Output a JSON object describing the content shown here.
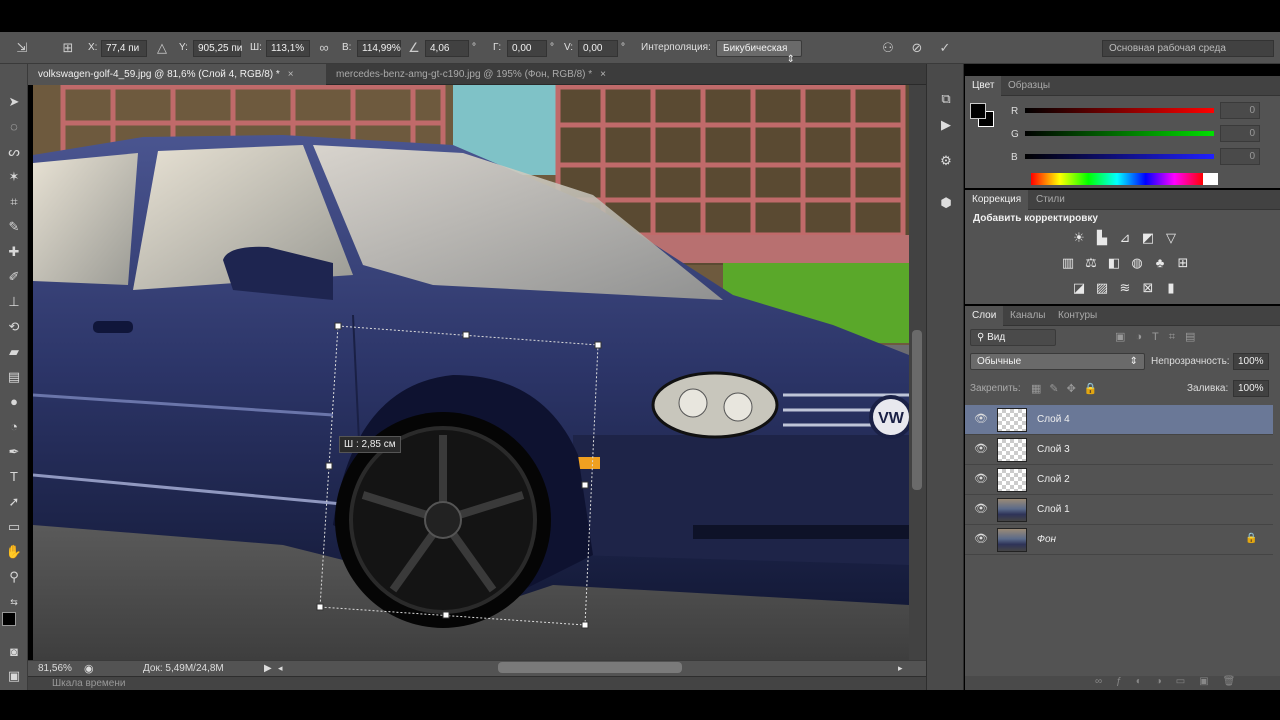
{
  "options_bar": {
    "x_label": "X:",
    "x_value": "77,4 пи",
    "y_label": "Y:",
    "y_value": "905,25 пи",
    "w_label": "Ш:",
    "w_value": "113,1%",
    "h_label": "В:",
    "h_value": "114,99%",
    "angle_value": "4,06",
    "hskew_label": "Г:",
    "hskew_value": "0,00",
    "vskew_label": "V:",
    "vskew_value": "0,00",
    "interp_label": "Интерполяция:",
    "interp_value": "Бикубическая",
    "workspace": "Основная рабочая среда"
  },
  "tabs": [
    {
      "label": "volkswagen-golf-4_59.jpg @ 81,6% (Слой 4, RGB/8) *"
    },
    {
      "label": "mercedes-benz-amg-gt-c190.jpg @ 195% (Фон, RGB/8) *"
    }
  ],
  "canvas": {
    "transform_tooltip": "Ш : 2,85 см",
    "brand": "VW"
  },
  "status": {
    "zoom": "81,56%",
    "doc": "Док: 5,49M/24,8M",
    "timeline": "Шкала времени"
  },
  "color_panel": {
    "tabs": [
      "Цвет",
      "Образцы"
    ],
    "sliders": [
      {
        "label": "R",
        "value": "0",
        "color": "#ff0000"
      },
      {
        "label": "G",
        "value": "0",
        "color": "#00e000"
      },
      {
        "label": "B",
        "value": "0",
        "color": "#2020ff"
      }
    ]
  },
  "adjust_panel": {
    "tabs": [
      "Коррекция",
      "Стили"
    ],
    "title": "Добавить корректировку",
    "row1": [
      "sun-icon",
      "levels-icon",
      "curves-icon",
      "exposure-icon",
      "triangle-icon"
    ],
    "row2": [
      "hsl-icon",
      "balance-icon",
      "bw-icon",
      "photo-filter-icon",
      "mixer-icon",
      "lookup-icon"
    ],
    "row3": [
      "invert-icon",
      "posterize-icon",
      "threshold-icon",
      "selective-color-icon",
      "gradient-map-icon"
    ]
  },
  "layers_panel": {
    "tabs": [
      "Слои",
      "Каналы",
      "Контуры"
    ],
    "filter": "Вид",
    "blend_mode": "Обычные",
    "opacity_label": "Непрозрачность:",
    "opacity_value": "100%",
    "lock_label": "Закрепить:",
    "fill_label": "Заливка:",
    "fill_value": "100%",
    "layers": [
      {
        "name": "Слой 4",
        "selected": true,
        "thumb": "transparent"
      },
      {
        "name": "Слой 3",
        "selected": false,
        "thumb": "transparent"
      },
      {
        "name": "Слой 2",
        "selected": false,
        "thumb": "transparent"
      },
      {
        "name": "Слой 1",
        "selected": false,
        "thumb": "image"
      },
      {
        "name": "Фон",
        "selected": false,
        "thumb": "image",
        "locked": true
      }
    ]
  }
}
